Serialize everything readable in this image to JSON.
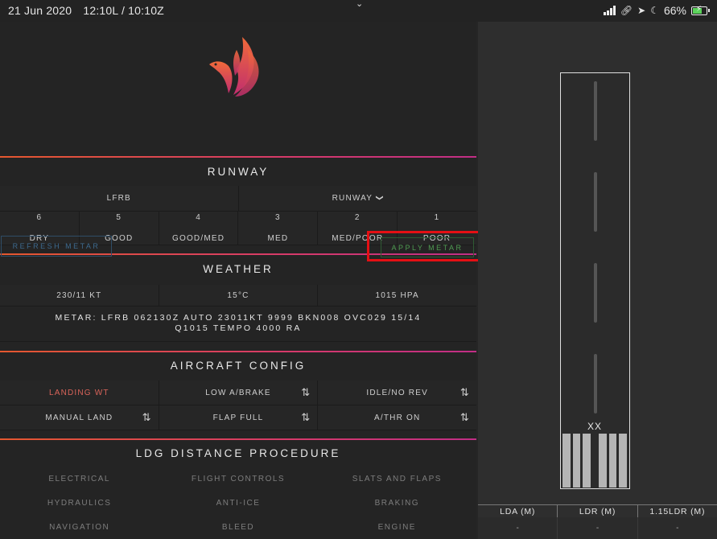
{
  "status_bar": {
    "date": "21 Jun 2020",
    "time": "12:10L / 10:10Z",
    "battery_percent": "66%",
    "battery_level": 0.66,
    "icons": [
      "signal-icon",
      "link-icon",
      "location-arrow-icon",
      "do-not-disturb-icon",
      "battery-icon"
    ]
  },
  "runway": {
    "title": "RUNWAY",
    "airport": "LFRB",
    "runway_select": "RUNWAY",
    "conditions": [
      {
        "code": "6",
        "label": "DRY"
      },
      {
        "code": "5",
        "label": "GOOD"
      },
      {
        "code": "4",
        "label": "GOOD/MED"
      },
      {
        "code": "3",
        "label": "MED"
      },
      {
        "code": "2",
        "label": "MED/POOR"
      },
      {
        "code": "1",
        "label": "POOR"
      }
    ]
  },
  "weather": {
    "title": "WEATHER",
    "refresh_label": "REFRESH METAR",
    "apply_label": "APPLY METAR",
    "wind": "230/11 KT",
    "temperature": "15°C",
    "pressure": "1015 HPA",
    "metar_line1": "METAR: LFRB 062130Z AUTO 23011KT 9999 BKN008 OVC029 15/14",
    "metar_line2": "Q1015 TEMPO 4000 RA"
  },
  "aircraft_config": {
    "title": "AIRCRAFT CONFIG",
    "rows": [
      [
        {
          "label": "LANDING WT",
          "arrows": ""
        },
        {
          "label": "LOW A/BRAKE",
          "arrows": "⇅"
        },
        {
          "label": "IDLE/NO REV",
          "arrows": "⇅"
        }
      ],
      [
        {
          "label": "MANUAL LAND",
          "arrows": "⇅"
        },
        {
          "label": "FLAP FULL",
          "arrows": "⇅"
        },
        {
          "label": "A/THR ON",
          "arrows": "⇅"
        }
      ]
    ]
  },
  "procedure": {
    "title": "LDG DISTANCE PROCEDURE",
    "items": [
      [
        "ELECTRICAL",
        "FLIGHT CONTROLS",
        "SLATS AND FLAPS"
      ],
      [
        "HYDRAULICS",
        "ANTI-ICE",
        "BRAKING"
      ],
      [
        "NAVIGATION",
        "BLEED",
        "ENGINE"
      ]
    ]
  },
  "runway_graphic": {
    "label": "XX"
  },
  "distances": {
    "headers": [
      "LDA (M)",
      "LDR (M)",
      "1.15LDR (M)"
    ],
    "values": [
      "-",
      "-",
      "-"
    ]
  },
  "colors": {
    "accent_gradient_start": "#e5582f",
    "accent_gradient_end": "#c12e86",
    "landing_wt_red": "#d9645a",
    "refresh_blue": "#3d6a8f",
    "apply_green": "#4f9b52",
    "highlight_red": "#e40f14"
  }
}
